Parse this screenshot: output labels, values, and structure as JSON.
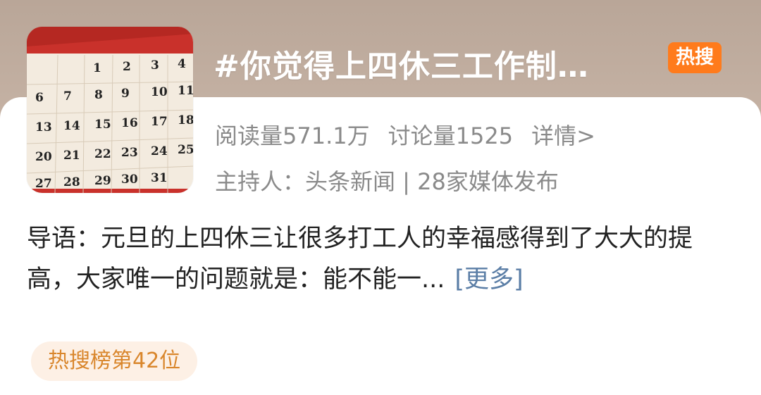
{
  "topic": {
    "title": "#你觉得上四休三工作制…",
    "badge": "热搜",
    "badge_color": "#ff7b1c"
  },
  "stats": {
    "reads": "阅读量571.1万",
    "discussions": "讨论量1525",
    "detail_link": "详情>"
  },
  "host_line": "主持人：头条新闻 | 28家媒体发布",
  "intro": {
    "text": "导语：元旦的上四休三让很多打工人的幸福感得到了大大的提高，大家唯一的问题就是：能不能一...",
    "more_link": "[更多]"
  },
  "rank_badge": "热搜榜第42位",
  "thumbnail": {
    "icon": "calendar-photo",
    "dates": [
      "1",
      "2",
      "3",
      "4",
      "6",
      "7",
      "8",
      "9",
      "10",
      "11",
      "13",
      "14",
      "15",
      "16",
      "17",
      "18",
      "20",
      "21",
      "22",
      "23",
      "24",
      "25",
      "27",
      "28",
      "29",
      "30",
      "31"
    ]
  }
}
